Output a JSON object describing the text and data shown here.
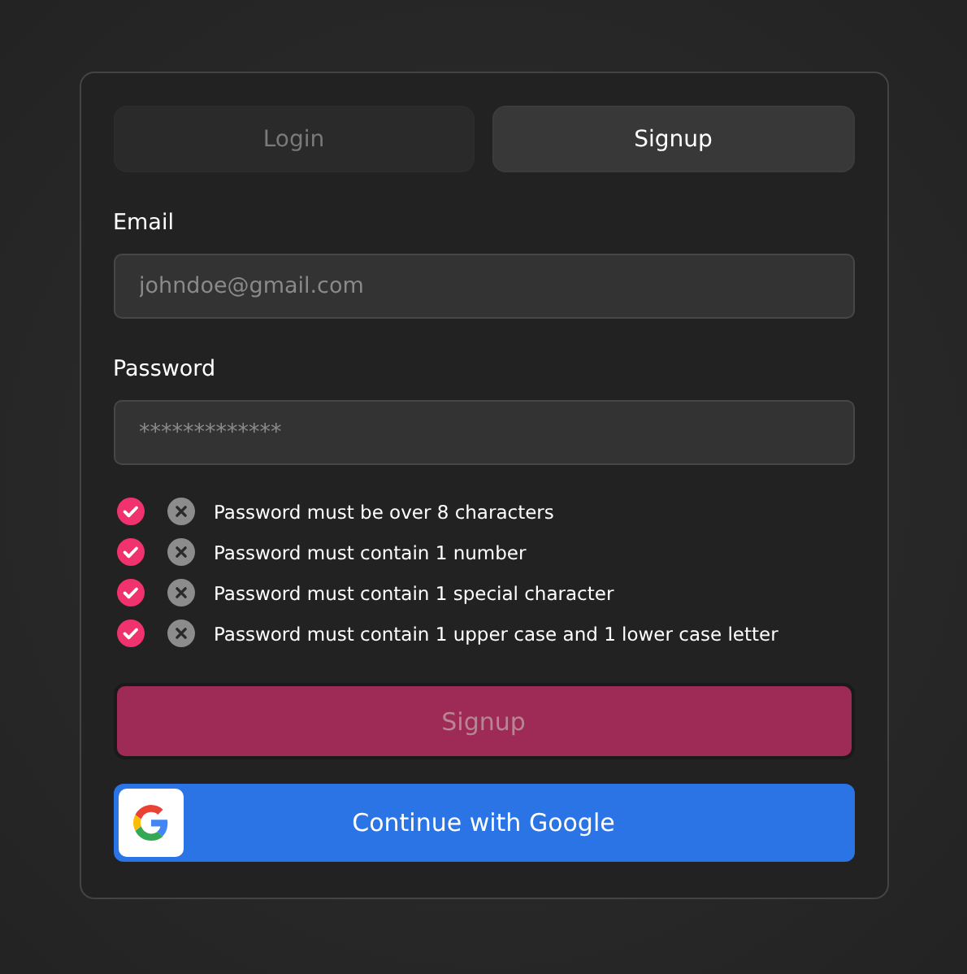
{
  "tabs": [
    {
      "label": "Login",
      "selected": false
    },
    {
      "label": "Signup",
      "selected": true
    }
  ],
  "email": {
    "label": "Email",
    "placeholder": "johndoe@gmail.com"
  },
  "password": {
    "label": "Password",
    "placeholder": "*************"
  },
  "rules": [
    {
      "text": "Password must be over 8 characters"
    },
    {
      "text": "Password must contain 1 number"
    },
    {
      "text": "Password must contain 1 special character"
    },
    {
      "text": "Password must contain 1 upper case and 1 lower case letter"
    }
  ],
  "submit": {
    "label": "Signup",
    "disabled": true
  },
  "google": {
    "label": "Continue with Google"
  }
}
